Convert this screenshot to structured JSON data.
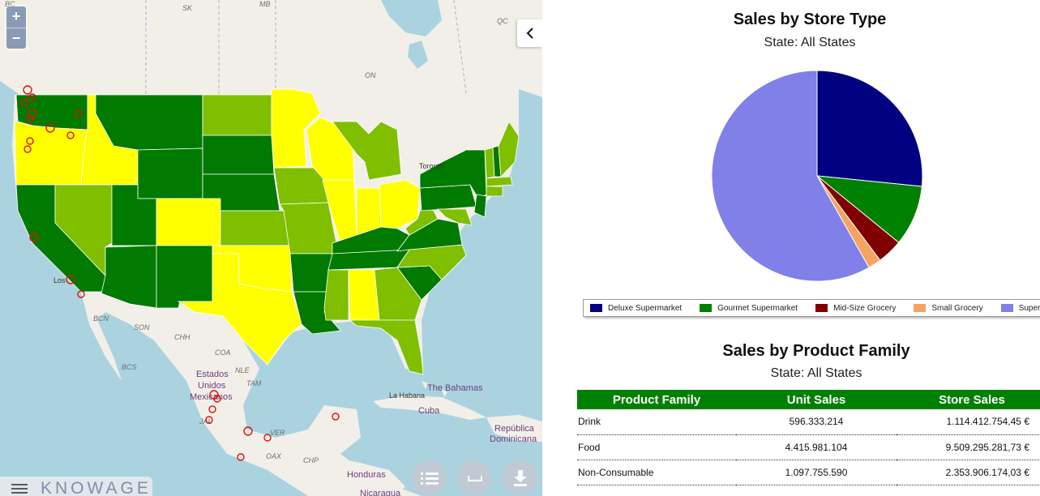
{
  "map": {
    "zoom_in_label": "+",
    "zoom_out_label": "−",
    "colors": {
      "water": "#aad3df",
      "land": "#f2efe9",
      "dark_green": "#007a00",
      "light_green": "#7fbf00",
      "yellow": "#ffff00",
      "marker": "#e01010"
    },
    "labels": {
      "sk": "SK",
      "mb": "MB",
      "qc": "QC",
      "on": "ON",
      "bc": "BC",
      "toronto": "Toronto",
      "bcn": "BCN",
      "son": "SON",
      "chh": "CHH",
      "bcs": "BCS",
      "coa": "COA",
      "nle": "NLE",
      "tam": "TAM",
      "estados": "Estados",
      "unidos": "Unidos",
      "mexicanos": "Mexicanos",
      "la_habana": "La Habana",
      "bahamas": "The Bahamas",
      "cuba": "Cuba",
      "republica": "República",
      "dominicana": "Dominicana",
      "honduras": "Honduras",
      "nicaragua": "Nicaragua",
      "ver": "VER",
      "oax": "OAX",
      "chp": "CHP",
      "jal": "JAL",
      "los": "Los"
    },
    "brand": "KNOWAGE",
    "icons": {
      "collapse": "chevron-left-icon",
      "legend": "list-icon",
      "crossfilter": "bracket-icon",
      "download": "download-icon",
      "menu": "hamburger-menu-icon"
    }
  },
  "store_type_chart": {
    "title": "Sales by Store Type",
    "subtitle": "State: All States"
  },
  "chart_data": {
    "type": "pie",
    "title": "Sales by Store Type",
    "subtitle": "State: All States",
    "legend_position": "bottom",
    "slices": [
      {
        "name": "Deluxe Supermarket",
        "value": 26.6,
        "color": "#000080"
      },
      {
        "name": "Gourmet Supermarket",
        "value": 9.3,
        "color": "#008000"
      },
      {
        "name": "Mid-Size Grocery",
        "value": 3.9,
        "color": "#800000"
      },
      {
        "name": "Small Grocery",
        "value": 2.0,
        "color": "#f4a460"
      },
      {
        "name": "Supermarket",
        "value": 58.2,
        "color": "#8080e8"
      }
    ]
  },
  "product_family": {
    "title": "Sales by Product Family",
    "subtitle": "State: All States",
    "header_color": "#008000",
    "columns": [
      "Product Family",
      "Unit Sales",
      "Store Sales"
    ],
    "rows": [
      [
        "Drink",
        "596.333.214",
        "1.114.412.754,45 €"
      ],
      [
        "Food",
        "4.415.981.104",
        "9.509.295.281,73 €"
      ],
      [
        "Non-Consumable",
        "1.097.755.590",
        "2.353.906.174,03 €"
      ]
    ]
  }
}
